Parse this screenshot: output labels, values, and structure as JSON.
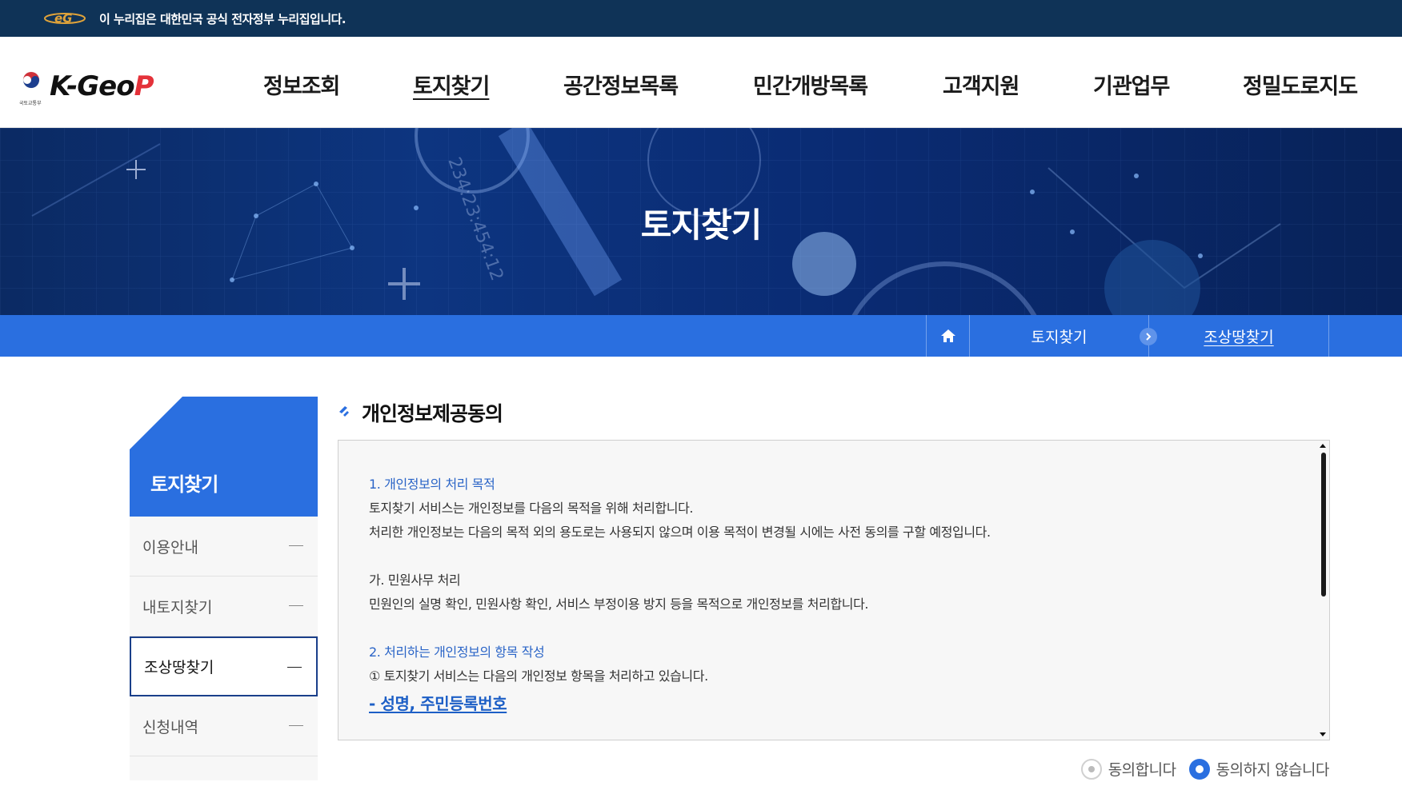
{
  "gov_banner": {
    "logo_text": "eG",
    "text": "이 누리집은 대한민국 공식 전자정부 누리집입니다."
  },
  "header": {
    "brand": "K-Geo",
    "brand_accent": "P",
    "ministry": "국토교통부",
    "nav": [
      "정보조회",
      "토지찾기",
      "공간정보목록",
      "민간개방목록",
      "고객지원",
      "기관업무",
      "정밀도로지도"
    ],
    "active_nav": "토지찾기"
  },
  "hero": {
    "title": "토지찾기",
    "decor_number": "234:23:454:12"
  },
  "breadcrumb": {
    "home_icon": "home-icon",
    "level1": "토지찾기",
    "level2": "조상땅찾기"
  },
  "sidebar": {
    "title": "토지찾기",
    "items": [
      {
        "label": "이용안내",
        "active": false
      },
      {
        "label": "내토지찾기",
        "active": false
      },
      {
        "label": "조상땅찾기",
        "active": true
      },
      {
        "label": "신청내역",
        "active": false
      }
    ]
  },
  "content": {
    "section_title": "개인정보제공동의",
    "terms": {
      "h1": "1. 개인정보의 처리 목적",
      "p1": "토지찾기 서비스는 개인정보를 다음의 목적을 위해 처리합니다.",
      "p2": "처리한 개인정보는 다음의 목적 외의 용도로는 사용되지 않으며 이용 목적이 변경될 시에는 사전 동의를 구할 예정입니다.",
      "sub1": "가. 민원사무 처리",
      "p3": "민원인의 실명 확인, 민원사항 확인, 서비스 부정이용 방지 등을 목적으로 개인정보를 처리합니다.",
      "h2": "2. 처리하는 개인정보의 항목 작성",
      "p4": "① 토지찾기 서비스는 다음의 개인정보 항목을 처리하고 있습니다.",
      "link": "- 성명, 주민등록번호"
    },
    "consent": {
      "agree": "동의합니다",
      "disagree": "동의하지 않습니다",
      "selected": "disagree"
    }
  },
  "colors": {
    "gov_bar": "#0f3357",
    "primary": "#2a6fe0",
    "link": "#1d5fc6",
    "brand_red": "#e4323a"
  }
}
